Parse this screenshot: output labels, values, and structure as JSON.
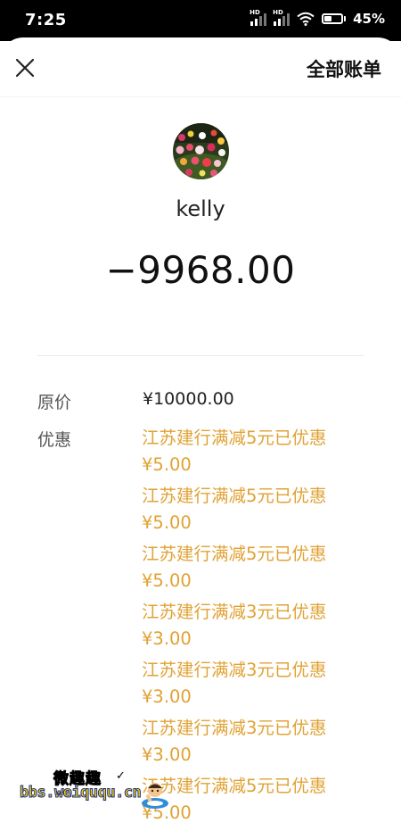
{
  "status_bar": {
    "time": "7:25",
    "signal_1_label": "HD",
    "signal_2_label": "HD",
    "battery_percent": "45%"
  },
  "header": {
    "close_icon": "close-icon",
    "action_label": "全部账单"
  },
  "payee": {
    "avatar_icon": "flower-avatar",
    "name": "kelly"
  },
  "amount": "−9968.00",
  "details": {
    "original_price_label": "原价",
    "original_price_value": "¥10000.00",
    "discount_label": "优惠",
    "discounts": [
      {
        "title": "江苏建行满减5元已优惠",
        "amount": "¥5.00"
      },
      {
        "title": "江苏建行满减5元已优惠",
        "amount": "¥5.00"
      },
      {
        "title": "江苏建行满减5元已优惠",
        "amount": "¥5.00"
      },
      {
        "title": "江苏建行满减3元已优惠",
        "amount": "¥3.00"
      },
      {
        "title": "江苏建行满减3元已优惠",
        "amount": "¥3.00"
      },
      {
        "title": "江苏建行满减3元已优惠",
        "amount": "¥3.00"
      },
      {
        "title": "江苏建行满减5元已优惠",
        "amount": "¥5.00"
      }
    ]
  },
  "watermark": {
    "name": "微趣趣",
    "url": "bbs.weiququ.cn"
  },
  "colors": {
    "discount": "#e0a234",
    "status_bar": "#000000"
  }
}
